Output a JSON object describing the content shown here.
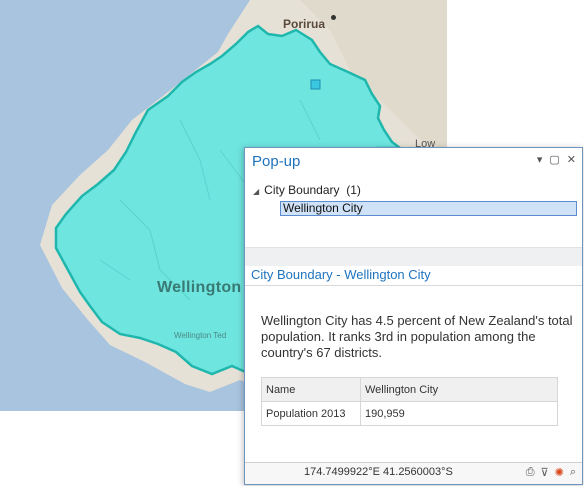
{
  "map": {
    "labels": {
      "porirua": "Porirua",
      "wellington": "Wellington",
      "wellington_ted": "Wellington Ted",
      "low": "Low"
    }
  },
  "popup": {
    "title": "Pop-up",
    "controls": {
      "menu": "▾",
      "maximize": "▢",
      "close": "✕"
    },
    "tree": {
      "layer_label": "City Boundary",
      "count": "(1)",
      "selected_item": "Wellington City"
    },
    "section_title": "City Boundary - Wellington City",
    "description": "Wellington City has 4.5 percent of New Zealand's total population. It ranks 3rd in population among the country's 67 districts.",
    "table": {
      "rows": [
        {
          "field": "Name",
          "value": "Wellington City"
        },
        {
          "field": "Population 2013",
          "value": "190,959"
        }
      ]
    },
    "status": {
      "coordinates": "174.7499922°E 41.2560003°S"
    }
  },
  "colors": {
    "water": "#a9c4df",
    "land": "#e6e1d6",
    "city_fill": "#62e6e0",
    "city_stroke": "#1fb7ad",
    "accent": "#1e73be"
  }
}
